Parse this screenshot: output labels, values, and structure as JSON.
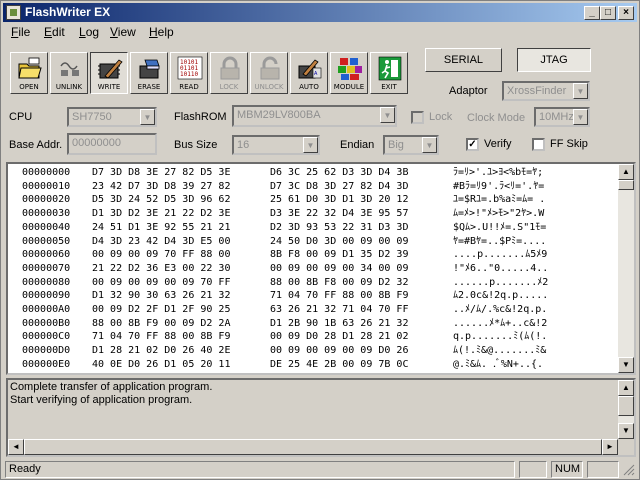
{
  "app": {
    "title": "FlashWriter EX"
  },
  "menu": [
    {
      "label": "File",
      "hotkey": "F",
      "rest": "ile"
    },
    {
      "label": "Edit",
      "hotkey": "E",
      "rest": "dit"
    },
    {
      "label": "Log",
      "hotkey": "L",
      "rest": "og"
    },
    {
      "label": "View",
      "hotkey": "V",
      "rest": "iew"
    },
    {
      "label": "Help",
      "hotkey": "H",
      "rest": "elp"
    }
  ],
  "toolbar": {
    "buttons": [
      {
        "label": "OPEN",
        "icon": "folder-open-icon",
        "enabled": true,
        "pressed": false
      },
      {
        "label": "UNLINK",
        "icon": "unlink-icon",
        "enabled": true,
        "pressed": false
      },
      {
        "label": "WRITE",
        "icon": "write-chip-icon",
        "enabled": true,
        "pressed": true
      },
      {
        "label": "ERASE",
        "icon": "erase-icon",
        "enabled": true,
        "pressed": false
      },
      {
        "label": "READ",
        "icon": "read-binary-icon",
        "enabled": true,
        "pressed": false
      },
      {
        "label": "LOCK",
        "icon": "lock-icon",
        "enabled": false,
        "pressed": false
      },
      {
        "label": "UNLOCK",
        "icon": "unlock-icon",
        "enabled": false,
        "pressed": false
      },
      {
        "label": "AUTO",
        "icon": "auto-icon",
        "enabled": true,
        "pressed": false
      },
      {
        "label": "MODULE",
        "icon": "module-blocks-icon",
        "enabled": true,
        "pressed": false
      },
      {
        "label": "EXIT",
        "icon": "exit-door-icon",
        "enabled": true,
        "pressed": false
      }
    ],
    "serial_label": "SERIAL",
    "jtag_label": "JTAG"
  },
  "settings": {
    "adaptor_label": "Adaptor",
    "adaptor_value": "XrossFinder",
    "cpu_label": "CPU",
    "cpu_value": "SH7750",
    "flashrom_label": "FlashROM",
    "flashrom_value": "MBM29LV800BA",
    "lock_label": "Lock",
    "lock_checked": false,
    "clock_mode_label": "Clock Mode",
    "clock_mode_value": "10MHz",
    "base_addr_label": "Base Addr.",
    "base_addr_value": "00000000",
    "bus_size_label": "Bus Size",
    "bus_size_value": "16",
    "endian_label": "Endian",
    "endian_value": "Big",
    "verify_label": "Verify",
    "verify_checked": true,
    "ffskip_label": "FF Skip",
    "ffskip_checked": false
  },
  "hex_rows": [
    {
      "addr": "00000000",
      "g1": "D7 3D D8 3E 27 82 D5 3E",
      "g2": "D6 3C 25 62 D3 3D D4 3B",
      "ascii": "ﾗ=ﾘ>'.ﾕ>ﾖ<%bﾓ=ﾔ;"
    },
    {
      "addr": "00000010",
      "g1": "23 42 D7 3D D8 39 27 82",
      "g2": "D7 3C D8 3D 27 82 D4 3D",
      "ascii": "#Bﾗ=ﾘ9'.ﾗ<ﾘ='.ﾔ="
    },
    {
      "addr": "00000020",
      "g1": "D5 3D 24 52 D5 3D 96 62",
      "g2": "25 61 D0 3D D1 3D 20 12",
      "ascii": "ﾕ=$Rﾕ=.b%aﾐ=ﾑ= ."
    },
    {
      "addr": "00000030",
      "g1": "D1 3D D2 3E 21 22 D2 3E",
      "g2": "D3 3E 22 32 D4 3E 95 57",
      "ascii": "ﾑ=ﾒ>!\"ﾒ>ﾓ>\"2ﾔ>.W"
    },
    {
      "addr": "00000040",
      "g1": "24 51 D1 3E 92 55 21 21",
      "g2": "D2 3D 93 53 22 31 D3 3D",
      "ascii": "$Qﾑ>.U!!ﾒ=.S\"1ﾓ="
    },
    {
      "addr": "00000050",
      "g1": "D4 3D 23 42 D4 3D E5 00",
      "g2": "24 50 D0 3D 00 09 00 09",
      "ascii": "ﾔ=#Bﾔ=..$Pﾐ=...."
    },
    {
      "addr": "00000060",
      "g1": "00 09 00 09 70 FF 88 00",
      "g2": "8B F8 00 09 D1 35 D2 39",
      "ascii": "....p.......ﾑ5ﾒ9"
    },
    {
      "addr": "00000070",
      "g1": "21 22 D2 36 E3 00 22 30",
      "g2": "00 09 00 09 00 34 00 09",
      "ascii": "!\"ﾒ6..\"0.....4.."
    },
    {
      "addr": "00000080",
      "g1": "00 09 00 09 00 09 70 FF",
      "g2": "88 00 8B F8 00 09 D2 32",
      "ascii": "......p.......ﾒ2"
    },
    {
      "addr": "00000090",
      "g1": "D1 32 90 30 63 26 21 32",
      "g2": "71 04 70 FF 88 00 8B F9",
      "ascii": "ﾑ2.0c&!2q.p....."
    },
    {
      "addr": "000000A0",
      "g1": "00 09 D2 2F D1 2F 90 25",
      "g2": "63 26 21 32 71 04 70 FF",
      "ascii": "..ﾒ/ﾑ/.%c&!2q.p."
    },
    {
      "addr": "000000B0",
      "g1": "88 00 8B F9 00 09 D2 2A",
      "g2": "D1 2B 90 1B 63 26 21 32",
      "ascii": "......ﾒ*ﾑ+..c&!2"
    },
    {
      "addr": "000000C0",
      "g1": "71 04 70 FF 88 00 8B F9",
      "g2": "00 09 D0 28 D1 28 21 02",
      "ascii": "q.p.......ﾐ(ﾑ(!."
    },
    {
      "addr": "000000D0",
      "g1": "D1 28 21 02 D0 26 40 2E",
      "g2": "00 09 00 09 00 09 D0 26",
      "ascii": "ﾑ(!.ﾐ&@.......ﾐ&"
    },
    {
      "addr": "000000E0",
      "g1": "40 0E D0 26 D1 05 20 11",
      "g2": "DE 25 4E 2B 00 09 7B 0C",
      "ascii": "@.ﾐ&ﾑ. .ﾞ%N+..{."
    }
  ],
  "log": [
    "Complete transfer of application program.",
    "Start verifying of application program."
  ],
  "status": {
    "text": "Ready",
    "num": "NUM"
  }
}
